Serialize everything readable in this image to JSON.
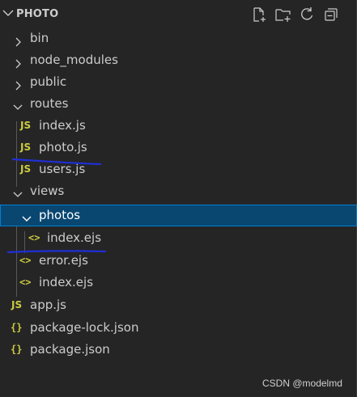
{
  "explorer": {
    "title": "PHOTO",
    "actions": [
      {
        "name": "new-file-icon"
      },
      {
        "name": "new-folder-icon"
      },
      {
        "name": "refresh-icon"
      },
      {
        "name": "collapse-all-icon"
      }
    ]
  },
  "tree": {
    "items": [
      {
        "label": "bin",
        "type": "folder",
        "state": "collapsed"
      },
      {
        "label": "node_modules",
        "type": "folder",
        "state": "collapsed"
      },
      {
        "label": "public",
        "type": "folder",
        "state": "collapsed"
      },
      {
        "label": "routes",
        "type": "folder",
        "state": "expanded"
      },
      {
        "label": "index.js",
        "type": "js",
        "icon_text": "JS"
      },
      {
        "label": "photo.js",
        "type": "js",
        "icon_text": "JS"
      },
      {
        "label": "users.js",
        "type": "js",
        "icon_text": "JS"
      },
      {
        "label": "views",
        "type": "folder",
        "state": "expanded"
      },
      {
        "label": "photos",
        "type": "folder",
        "state": "expanded",
        "selected": true
      },
      {
        "label": "index.ejs",
        "type": "ejs",
        "icon_text": "<>"
      },
      {
        "label": "error.ejs",
        "type": "ejs",
        "icon_text": "<>"
      },
      {
        "label": "index.ejs",
        "type": "ejs",
        "icon_text": "<>"
      },
      {
        "label": "app.js",
        "type": "js",
        "icon_text": "JS"
      },
      {
        "label": "package-lock.json",
        "type": "json",
        "icon_text": "{}"
      },
      {
        "label": "package.json",
        "type": "json",
        "icon_text": "{}"
      }
    ]
  },
  "colors": {
    "background": "#252526",
    "selection": "#094771",
    "selection_border": "#007fd4",
    "icon_yellow": "#cbcb41",
    "annotation_pen": "#1f2fd6"
  },
  "watermark": "CSDN @modelmd"
}
